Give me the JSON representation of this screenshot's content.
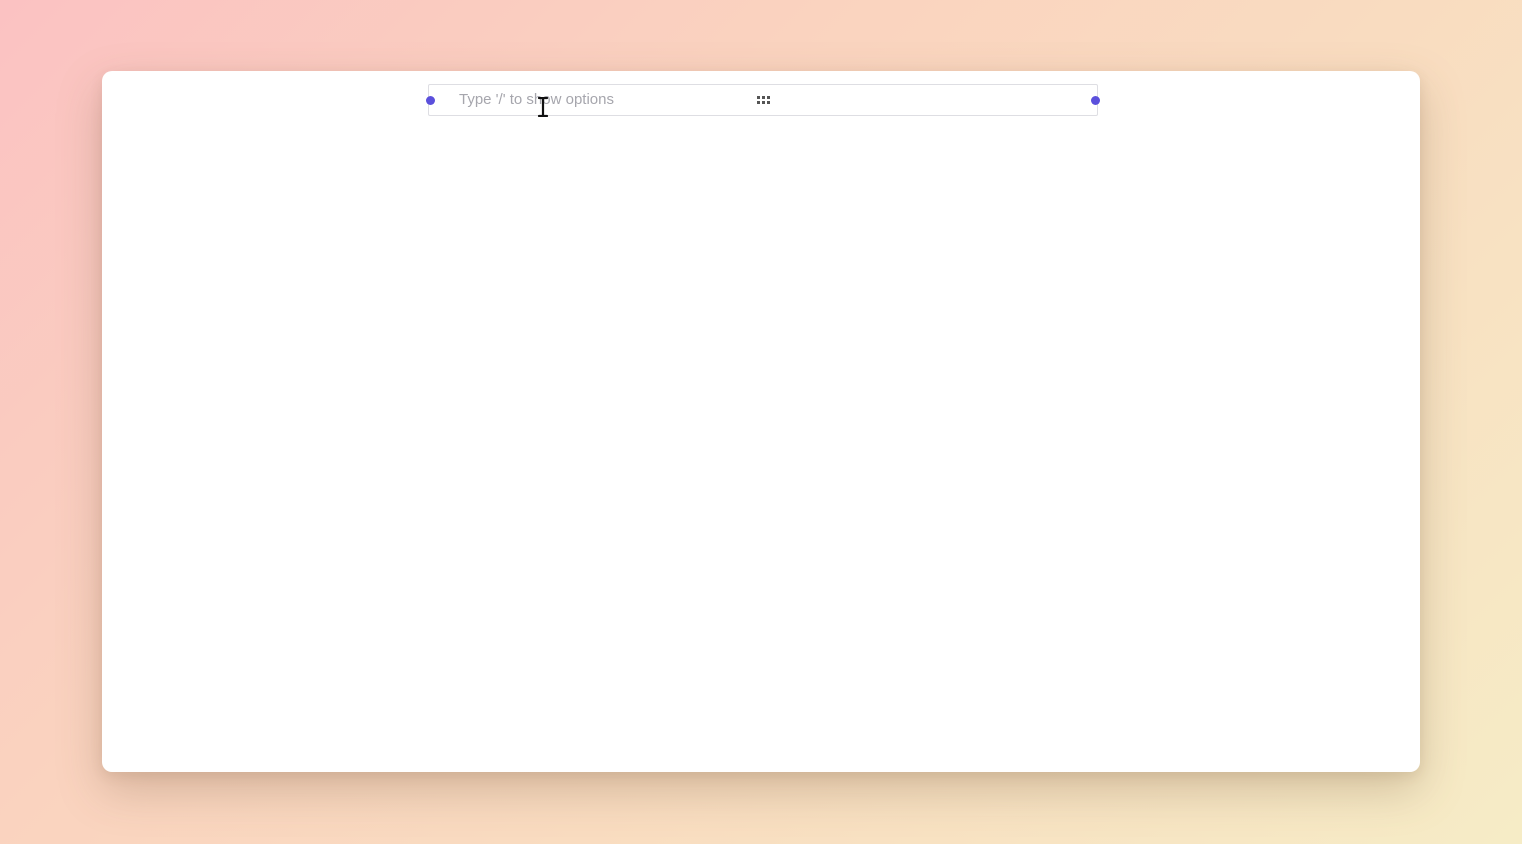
{
  "editor": {
    "block": {
      "placeholder": "Type '/' to show options",
      "drag_icon": "grid-dots-icon"
    },
    "colors": {
      "handle": "#5b50dc",
      "placeholder": "#a6a6ad",
      "block_border": "#dedee3"
    }
  },
  "cursor": {
    "icon": "text-cursor-icon"
  }
}
